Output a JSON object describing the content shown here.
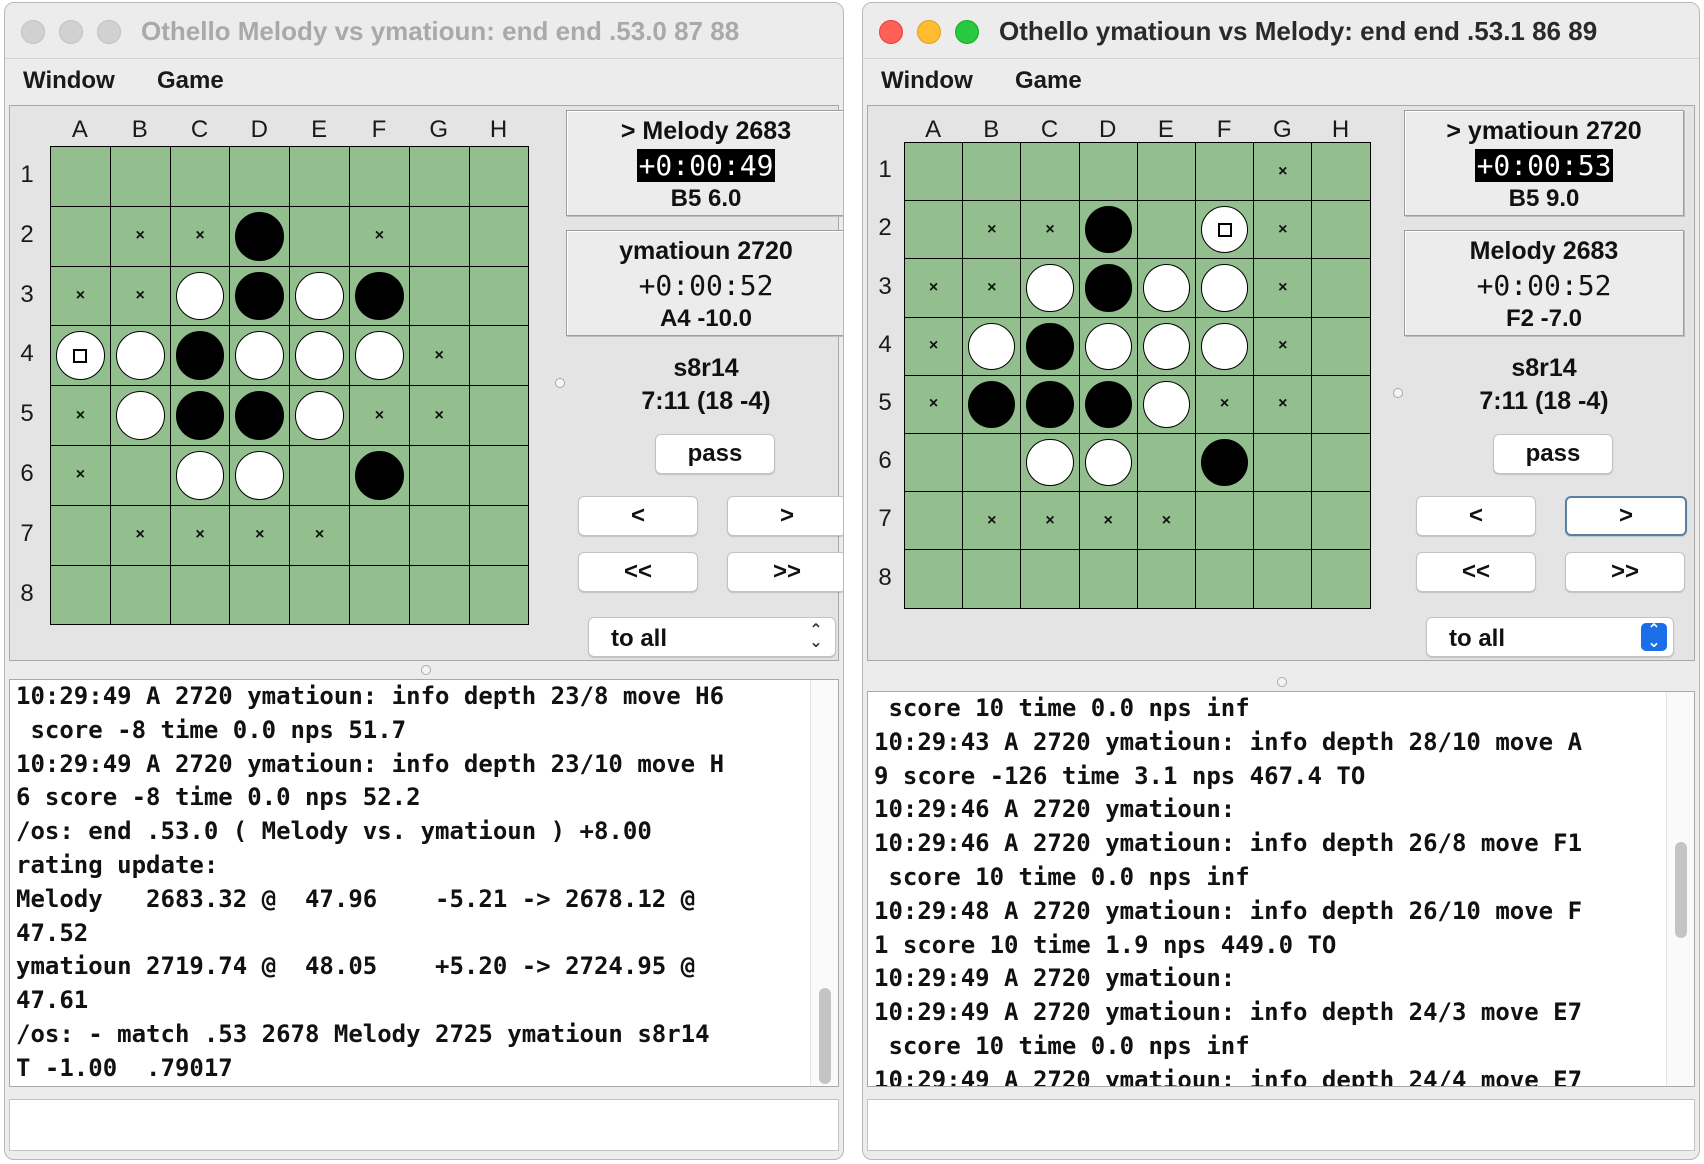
{
  "left": {
    "title": "Othello Melody vs ymatioun: end end .53.0 87 88",
    "menu": [
      "Window",
      "Game"
    ],
    "cols": [
      "A",
      "B",
      "C",
      "D",
      "E",
      "F",
      "G",
      "H"
    ],
    "rows": [
      "1",
      "2",
      "3",
      "4",
      "5",
      "6",
      "7",
      "8"
    ],
    "board": [
      "........",
      "...B....",
      "..WBWB..",
      "WWBWWW..",
      ".WBBW...",
      "..WW.B..",
      "........",
      "........"
    ],
    "marks": [
      [
        1,
        1
      ],
      [
        1,
        2
      ],
      [
        1,
        5
      ],
      [
        2,
        0
      ],
      [
        2,
        1
      ],
      [
        3,
        6
      ],
      [
        4,
        0
      ],
      [
        4,
        5
      ],
      [
        4,
        6
      ],
      [
        5,
        0
      ],
      [
        6,
        1
      ],
      [
        6,
        2
      ],
      [
        6,
        3
      ],
      [
        6,
        4
      ]
    ],
    "last_move": [
      3,
      0
    ],
    "mark_symbol": "×",
    "players": [
      {
        "name": "> Melody 2683",
        "clock": "+0:00:49",
        "eval": "B5 6.0",
        "to_move": true
      },
      {
        "name": "ymatioun 2720",
        "clock": "+0:00:52",
        "eval": "A4 -10.0",
        "to_move": false
      }
    ],
    "game_type": "s8r14",
    "time_control": "7:11 (18 -4)",
    "buttons": {
      "pass": "pass",
      "prev": "<",
      "next": ">",
      "first": "<<",
      "last": ">>"
    },
    "select_value": "to all",
    "console": [
      "10:29:49 A 2720 ymatioun: info depth 23/8 move H6",
      " score -8 time 0.0 nps 51.7",
      "10:29:49 A 2720 ymatioun: info depth 23/10 move H",
      "6 score -8 time 0.0 nps 52.2",
      "/os: end .53.0 ( Melody vs. ymatioun ) +8.00",
      "rating update:",
      "Melody   2683.32 @  47.96    -5.21 -> 2678.12 @",
      "47.52",
      "ymatioun 2719.74 @  48.05    +5.20 -> 2724.95 @",
      "47.61",
      "/os: - match .53 2678 Melody 2725 ymatioun s8r14",
      "T -1.00  .79017"
    ],
    "input_value": ""
  },
  "right": {
    "title": "Othello ymatioun vs Melody: end end .53.1 86 89",
    "menu": [
      "Window",
      "Game"
    ],
    "cols": [
      "A",
      "B",
      "C",
      "D",
      "E",
      "F",
      "G",
      "H"
    ],
    "rows": [
      "1",
      "2",
      "3",
      "4",
      "5",
      "6",
      "7",
      "8"
    ],
    "board": [
      "........",
      "...B.W..",
      "..WBWW..",
      ".WBWWW..",
      ".BBBW...",
      "..WW.B..",
      "........",
      "........"
    ],
    "marks": [
      [
        0,
        6
      ],
      [
        1,
        1
      ],
      [
        1,
        2
      ],
      [
        1,
        6
      ],
      [
        2,
        0
      ],
      [
        2,
        1
      ],
      [
        2,
        6
      ],
      [
        3,
        0
      ],
      [
        3,
        6
      ],
      [
        4,
        0
      ],
      [
        4,
        5
      ],
      [
        4,
        6
      ],
      [
        6,
        1
      ],
      [
        6,
        2
      ],
      [
        6,
        3
      ],
      [
        6,
        4
      ]
    ],
    "last_move": [
      1,
      5
    ],
    "mark_symbol": "×",
    "players": [
      {
        "name": "> ymatioun 2720",
        "clock": "+0:00:53",
        "eval": "B5 9.0",
        "to_move": true
      },
      {
        "name": "Melody 2683",
        "clock": "+0:00:52",
        "eval": "F2 -7.0",
        "to_move": false
      }
    ],
    "game_type": "s8r14",
    "time_control": "7:11 (18 -4)",
    "buttons": {
      "pass": "pass",
      "prev": "<",
      "next": ">",
      "first": "<<",
      "last": ">>"
    },
    "select_value": "to all",
    "console": [
      " score 10 time 0.0 nps inf",
      "10:29:43 A 2720 ymatioun: info depth 28/10 move A",
      "9 score -126 time 3.1 nps 467.4 TO",
      "10:29:46 A 2720 ymatioun:",
      "10:29:46 A 2720 ymatioun: info depth 26/8 move F1",
      " score 10 time 0.0 nps inf",
      "10:29:48 A 2720 ymatioun: info depth 26/10 move F",
      "1 score 10 time 1.9 nps 449.0 TO",
      "10:29:49 A 2720 ymatioun:",
      "10:29:49 A 2720 ymatioun: info depth 24/3 move E7",
      " score 10 time 0.0 nps inf",
      "10:29:49 A 2720 ymatioun: info depth 24/4 move E7"
    ],
    "input_value": ""
  },
  "colors": {
    "board_green": "#93bf8f",
    "close_red": "#fe5f57",
    "minimize_yellow": "#febc2e",
    "zoom_green": "#28c840",
    "select_blue": "#1a6fe8"
  }
}
